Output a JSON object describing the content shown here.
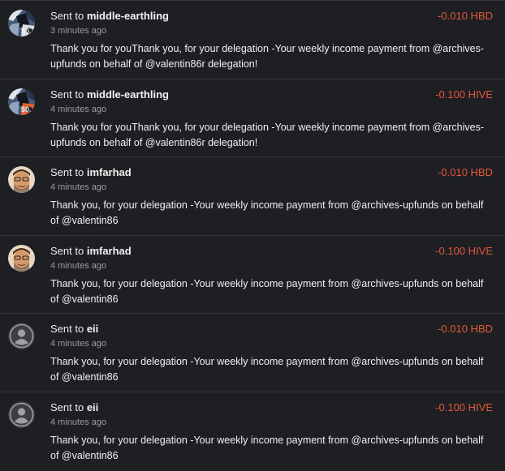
{
  "transfers": [
    {
      "prefix": "Sent to",
      "account": "middle-earthling",
      "time": "3 minutes ago",
      "amount": "-0.010 HBD",
      "memo": "Thank you for youThank you, for your delegation -Your weekly income payment from @archives-upfunds on behalf of @valentin86r delegation!",
      "avatar": "artwork-avatar-icon"
    },
    {
      "prefix": "Sent to",
      "account": "middle-earthling",
      "time": "4 minutes ago",
      "amount": "-0.100 HIVE",
      "memo": "Thank you for youThank you, for your delegation -Your weekly income payment from @archives-upfunds on behalf of @valentin86r delegation!",
      "avatar": "artwork-avatar-icon"
    },
    {
      "prefix": "Sent to",
      "account": "imfarhad",
      "time": "4 minutes ago",
      "amount": "-0.010 HBD",
      "memo": "Thank you, for your delegation -Your weekly income payment from @archives-upfunds on behalf of @valentin86",
      "avatar": "photo-avatar-icon"
    },
    {
      "prefix": "Sent to",
      "account": "imfarhad",
      "time": "4 minutes ago",
      "amount": "-0.100 HIVE",
      "memo": "Thank you, for your delegation -Your weekly income payment from @archives-upfunds on behalf of @valentin86",
      "avatar": "photo-avatar-icon"
    },
    {
      "prefix": "Sent to",
      "account": "eii",
      "time": "4 minutes ago",
      "amount": "-0.010 HBD",
      "memo": "Thank you, for your delegation -Your weekly income payment from @archives-upfunds on behalf of @valentin86",
      "avatar": "default-user-avatar-icon"
    },
    {
      "prefix": "Sent to",
      "account": "eii",
      "time": "4 minutes ago",
      "amount": "-0.100 HIVE",
      "memo": "Thank you, for your delegation -Your weekly income payment from @archives-upfunds on behalf of @valentin86",
      "avatar": "default-user-avatar-icon"
    }
  ],
  "colors": {
    "background": "#1e1f23",
    "amount": "#e4583b",
    "divider": "#34353a",
    "muted_text": "#9a9ca2"
  }
}
